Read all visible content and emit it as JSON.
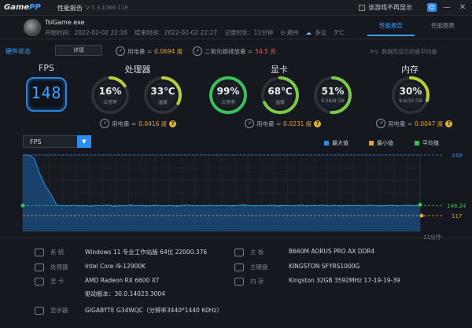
{
  "titlebar": {
    "logo_main": "Game",
    "logo_accent": "PP",
    "title": "性能报告",
    "version": "V 5.3.1066.118",
    "no_popup": "该游戏不再显示",
    "minimize": "—",
    "close": "✕"
  },
  "session": {
    "game": "TslGame.exe",
    "start": "开始时间：2022-02-02 22:16",
    "end": "结束时间：2022-02-02 22:27",
    "duration": "记录时长：11分钟",
    "location": "郑州",
    "weather": "多云",
    "temp": "3℃"
  },
  "tabs": [
    {
      "label": "性能报告"
    },
    {
      "label": "性能图表"
    }
  ],
  "hw": {
    "state_label": "硬件状态",
    "detail_btn": "详情",
    "power_label": "用电量 =",
    "power_value": "0.0694 度",
    "co2_label": "二氧化碳排放量 =",
    "co2_value": "54.5 克",
    "ps": "P.S. 数据页显示的是平均值"
  },
  "fps": {
    "title": "FPS",
    "value": "148"
  },
  "cpu": {
    "title": "处理器",
    "usage": "16%",
    "usage_pct": 16,
    "usage_label": "占用率",
    "temp": "33℃",
    "temp_pct": 33,
    "temp_label": "温度",
    "power_label": "用电量 =",
    "power": "0.0416 度"
  },
  "gpu": {
    "title": "显卡",
    "usage": "99%",
    "usage_pct": 99,
    "usage_label": "占用率",
    "temp": "68℃",
    "temp_pct": 68,
    "temp_label": "温度",
    "vram": "51%",
    "vram_pct": 51,
    "vram_label": "4.08/8 GB",
    "power_label": "用电量 =",
    "power": "0.0231 度"
  },
  "mem": {
    "title": "内存",
    "usage": "30%",
    "usage_pct": 30,
    "usage_label": "9.6/32 GB",
    "power_label": "用电量 =",
    "power": "0.0047 度"
  },
  "chart": {
    "selector": "FPS",
    "legend_max": "最大值",
    "legend_min": "最小值",
    "legend_avg": "平均值",
    "max_label": "439",
    "avg_label": "148.24",
    "min_label": "117",
    "x_end": "11分钟",
    "colors": {
      "max": "#2a8df0",
      "min": "#e5a33b",
      "avg": "#3bbf5e",
      "line": "#2a8df0"
    }
  },
  "chart_data": {
    "type": "area",
    "series": [
      {
        "name": "FPS",
        "values": [
          439,
          439,
          420,
          330,
          260,
          210,
          150,
          148,
          146,
          150,
          145,
          147,
          144,
          149,
          146,
          151,
          143,
          147,
          145,
          152,
          146,
          148,
          144,
          150,
          147,
          145,
          149,
          143,
          147,
          151,
          146,
          148,
          145,
          150,
          146,
          148,
          147,
          145,
          149,
          152,
          147,
          145,
          148,
          146,
          150,
          144,
          149,
          147,
          146,
          151,
          145,
          148,
          147,
          150,
          146,
          149,
          145,
          148,
          147,
          149,
          146,
          150,
          147,
          145,
          148,
          149,
          146,
          148,
          150,
          147,
          148
        ]
      }
    ],
    "ylim": [
      117,
      439
    ],
    "max": 439,
    "avg": 148.24,
    "min": 117,
    "xlabel": "11分钟"
  },
  "system": [
    {
      "key": "系 统",
      "value": "Windows 11 专业工作站版 64位   22000.376",
      "icon": "monitor-icon"
    },
    {
      "key": "处理器",
      "value": "Intel Core i9-12900K",
      "icon": "cpu-icon"
    },
    {
      "key": "显 卡",
      "value": "AMD Radeon RX 6600 XT",
      "icon": "gpu-icon"
    },
    {
      "key": "",
      "value": "驱动版本：30.0.14023.3004",
      "icon": ""
    },
    {
      "key": "显示器",
      "value": "GIGABYTE G34WQC（分辨率3440*1440 60Hz）",
      "icon": "display-icon"
    }
  ],
  "system_right": [
    {
      "key": "主 板",
      "value": "B660M AORUS PRO AX DDR4",
      "icon": "board-icon"
    },
    {
      "key": "主硬盘",
      "value": "KINGSTON SFYRS1000G",
      "icon": "disk-icon"
    },
    {
      "key": "内 存",
      "value": "Kingston 32GB 3592MHz 17-19-19-39",
      "icon": "memory-icon"
    }
  ]
}
